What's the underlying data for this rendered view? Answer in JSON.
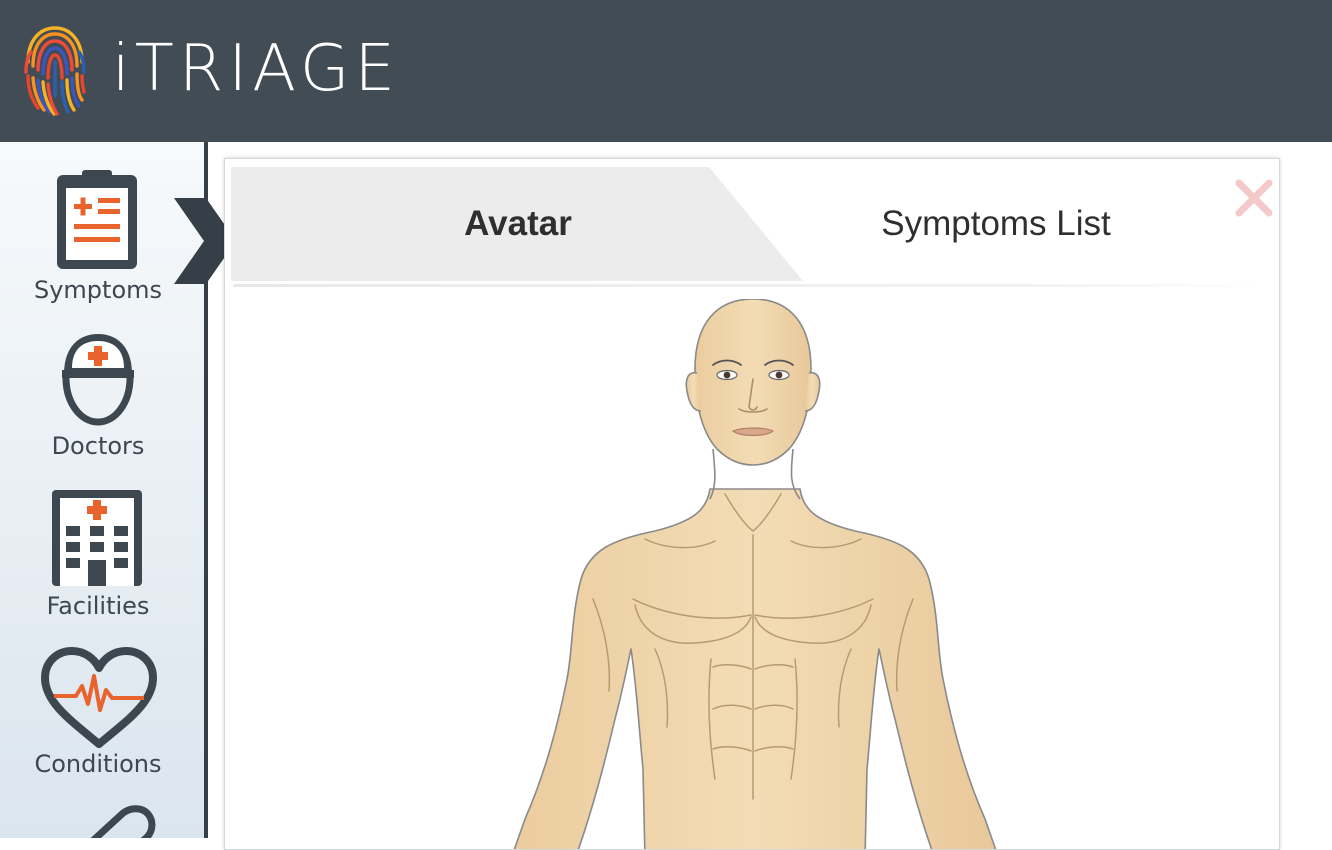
{
  "header": {
    "brand": "iTRIAGE",
    "logo_icon": "fingerprint-logo-icon",
    "background": "#414c55"
  },
  "sidebar": {
    "active_index": 0,
    "accent": "#e8642c",
    "items": [
      {
        "label": "Symptoms",
        "icon": "clipboard-icon"
      },
      {
        "label": "Doctors",
        "icon": "doctor-icon"
      },
      {
        "label": "Facilities",
        "icon": "hospital-icon"
      },
      {
        "label": "Conditions",
        "icon": "heart-pulse-icon"
      },
      {
        "label": "",
        "icon": "pill-icon"
      }
    ]
  },
  "panel": {
    "tabs": [
      {
        "label": "Avatar",
        "active": true
      },
      {
        "label": "Symptoms List",
        "active": false
      }
    ],
    "close_icon": "close-icon",
    "avatar_figure": "human-body-avatar"
  }
}
